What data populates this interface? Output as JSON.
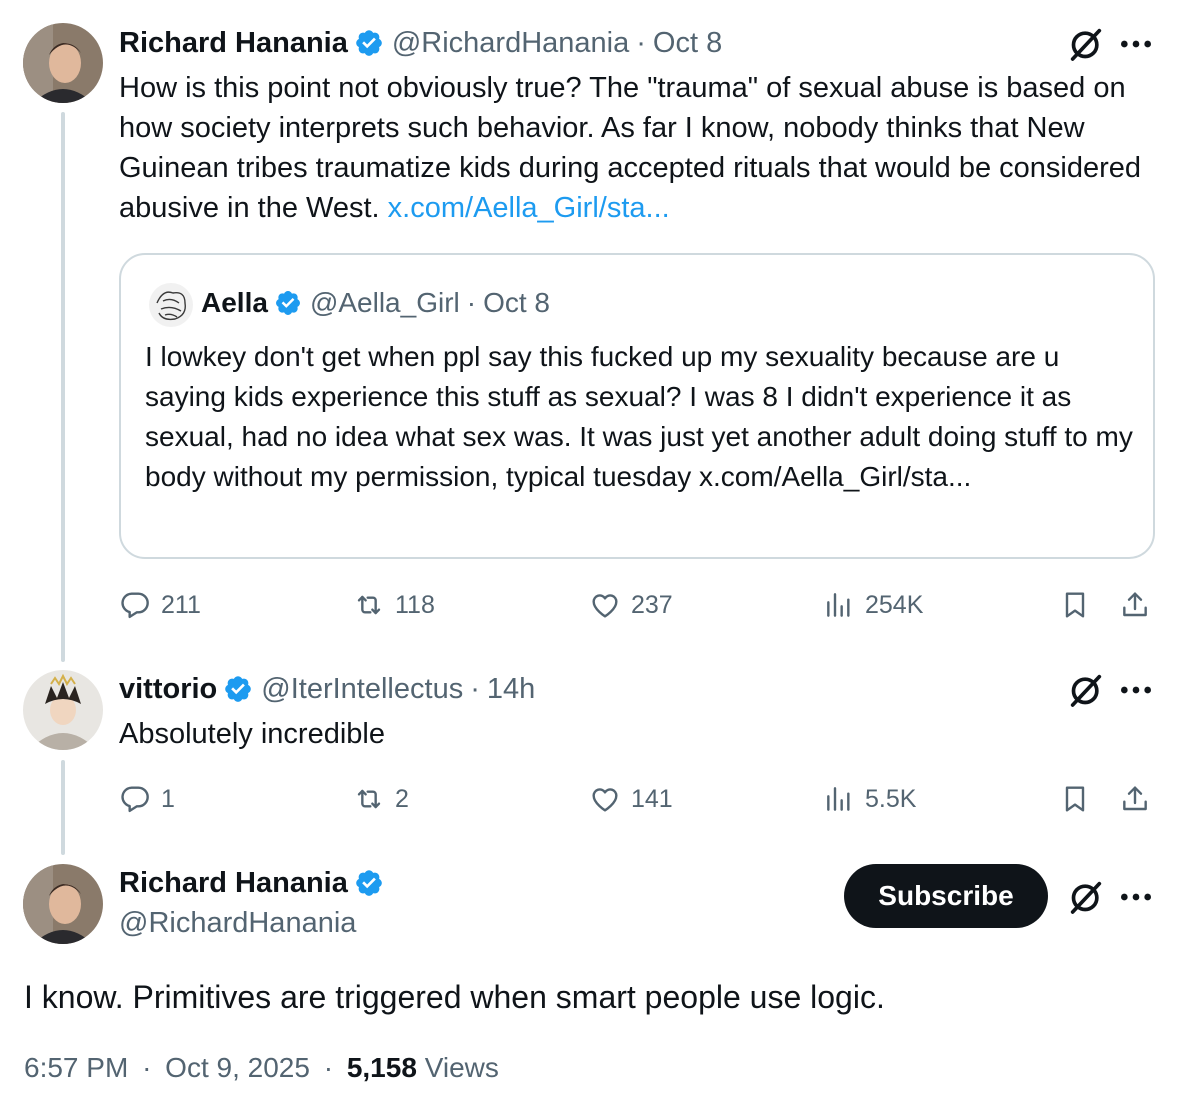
{
  "colors": {
    "accent": "#1d9bf0",
    "text": "#0f1419",
    "secondary": "#536471",
    "border": "#cfd9de"
  },
  "tweet1": {
    "name": "Richard Hanania",
    "handle": "@RichardHanania",
    "sep": "·",
    "time": "Oct 8",
    "text_before": "How is this point not obviously true? The \"trauma\" of sexual abuse is based on how society interprets such behavior. As far I know, nobody thinks that New Guinean tribes traumatize kids during accepted rituals that would be considered abusive in the West.",
    "link": "x.com/Aella_Girl/sta...",
    "quote": {
      "name": "Aella",
      "handle": "@Aella_Girl",
      "sep": "·",
      "time": "Oct 8",
      "text": "I lowkey don't get when ppl say this fucked up my sexuality because are u saying kids experience this stuff as sexual? I was 8 I didn't experience it as sexual, had no idea what sex was. It was just yet another adult doing stuff to my body without my permission, typical tuesday x.com/Aella_Girl/sta..."
    },
    "stats": {
      "replies": "211",
      "reposts": "118",
      "likes": "237",
      "views": "254K"
    }
  },
  "tweet2": {
    "name": "vittorio",
    "handle": "@IterIntellectus",
    "sep": "·",
    "time": "14h",
    "text": "Absolutely incredible",
    "stats": {
      "replies": "1",
      "reposts": "2",
      "likes": "141",
      "views": "5.5K"
    }
  },
  "tweet3": {
    "name": "Richard Hanania",
    "handle": "@RichardHanania",
    "subscribe_label": "Subscribe",
    "text": "I know. Primitives are triggered when smart people use logic.",
    "time": "6:57 PM",
    "sep": "·",
    "date": "Oct 9, 2025",
    "views_count": "5,158",
    "views_label": "Views"
  },
  "icons": [
    "verified-badge-icon",
    "grok-icon",
    "more-icon",
    "reply-icon",
    "repost-icon",
    "like-icon",
    "views-icon",
    "bookmark-icon",
    "share-icon"
  ]
}
